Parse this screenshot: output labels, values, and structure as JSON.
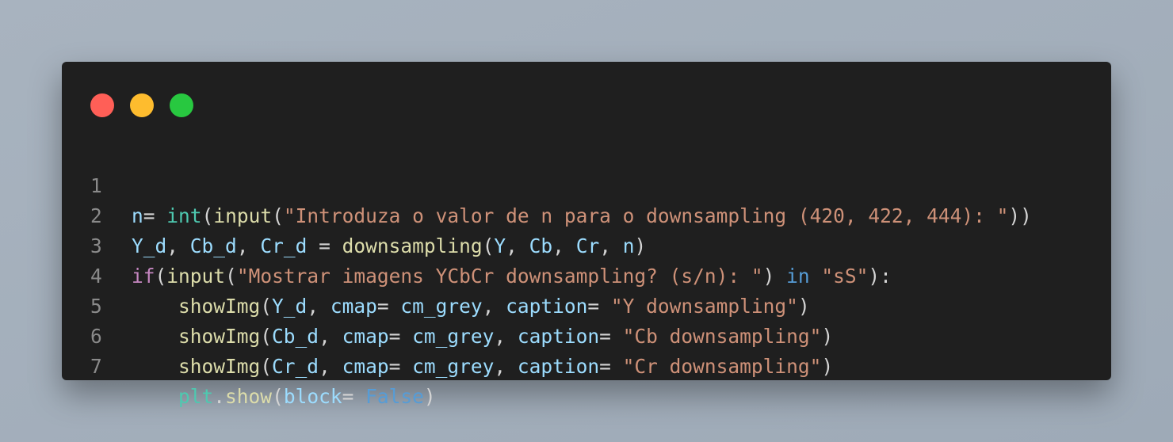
{
  "window": {
    "controls": [
      {
        "name": "close",
        "color": "#ff5f57"
      },
      {
        "name": "minimize",
        "color": "#febc2e"
      },
      {
        "name": "maximize",
        "color": "#28c840"
      }
    ]
  },
  "code": {
    "line_numbers": [
      "1",
      "2",
      "3",
      "4",
      "5",
      "6",
      "7"
    ],
    "lines": [
      [
        {
          "t": "n",
          "c": "var"
        },
        {
          "t": "= ",
          "c": "p"
        },
        {
          "t": "int",
          "c": "builtin"
        },
        {
          "t": "(",
          "c": "p"
        },
        {
          "t": "input",
          "c": "fn"
        },
        {
          "t": "(",
          "c": "p"
        },
        {
          "t": "\"Introduza o valor de n para o downsampling (420, 422, 444): \"",
          "c": "str"
        },
        {
          "t": "))",
          "c": "p"
        }
      ],
      [
        {
          "t": "Y_d",
          "c": "var"
        },
        {
          "t": ", ",
          "c": "p"
        },
        {
          "t": "Cb_d",
          "c": "var"
        },
        {
          "t": ", ",
          "c": "p"
        },
        {
          "t": "Cr_d",
          "c": "var"
        },
        {
          "t": " = ",
          "c": "p"
        },
        {
          "t": "downsampling",
          "c": "fn"
        },
        {
          "t": "(",
          "c": "p"
        },
        {
          "t": "Y",
          "c": "var"
        },
        {
          "t": ", ",
          "c": "p"
        },
        {
          "t": "Cb",
          "c": "var"
        },
        {
          "t": ", ",
          "c": "p"
        },
        {
          "t": "Cr",
          "c": "var"
        },
        {
          "t": ", ",
          "c": "p"
        },
        {
          "t": "n",
          "c": "var"
        },
        {
          "t": ")",
          "c": "p"
        }
      ],
      [
        {
          "t": "if",
          "c": "kw"
        },
        {
          "t": "(",
          "c": "p"
        },
        {
          "t": "input",
          "c": "fn"
        },
        {
          "t": "(",
          "c": "p"
        },
        {
          "t": "\"Mostrar imagens YCbCr downsampling? (s/n): \"",
          "c": "str"
        },
        {
          "t": ") ",
          "c": "p"
        },
        {
          "t": "in",
          "c": "const"
        },
        {
          "t": " ",
          "c": "p"
        },
        {
          "t": "\"sS\"",
          "c": "str"
        },
        {
          "t": "):",
          "c": "p"
        }
      ],
      [
        {
          "t": "    ",
          "c": "p"
        },
        {
          "t": "showImg",
          "c": "fn"
        },
        {
          "t": "(",
          "c": "p"
        },
        {
          "t": "Y_d",
          "c": "var"
        },
        {
          "t": ", ",
          "c": "p"
        },
        {
          "t": "cmap",
          "c": "var"
        },
        {
          "t": "= ",
          "c": "p"
        },
        {
          "t": "cm_grey",
          "c": "var"
        },
        {
          "t": ", ",
          "c": "p"
        },
        {
          "t": "caption",
          "c": "var"
        },
        {
          "t": "= ",
          "c": "p"
        },
        {
          "t": "\"Y downsampling\"",
          "c": "str"
        },
        {
          "t": ")",
          "c": "p"
        }
      ],
      [
        {
          "t": "    ",
          "c": "p"
        },
        {
          "t": "showImg",
          "c": "fn"
        },
        {
          "t": "(",
          "c": "p"
        },
        {
          "t": "Cb_d",
          "c": "var"
        },
        {
          "t": ", ",
          "c": "p"
        },
        {
          "t": "cmap",
          "c": "var"
        },
        {
          "t": "= ",
          "c": "p"
        },
        {
          "t": "cm_grey",
          "c": "var"
        },
        {
          "t": ", ",
          "c": "p"
        },
        {
          "t": "caption",
          "c": "var"
        },
        {
          "t": "= ",
          "c": "p"
        },
        {
          "t": "\"Cb downsampling\"",
          "c": "str"
        },
        {
          "t": ")",
          "c": "p"
        }
      ],
      [
        {
          "t": "    ",
          "c": "p"
        },
        {
          "t": "showImg",
          "c": "fn"
        },
        {
          "t": "(",
          "c": "p"
        },
        {
          "t": "Cr_d",
          "c": "var"
        },
        {
          "t": ", ",
          "c": "p"
        },
        {
          "t": "cmap",
          "c": "var"
        },
        {
          "t": "= ",
          "c": "p"
        },
        {
          "t": "cm_grey",
          "c": "var"
        },
        {
          "t": ", ",
          "c": "p"
        },
        {
          "t": "caption",
          "c": "var"
        },
        {
          "t": "= ",
          "c": "p"
        },
        {
          "t": "\"Cr downsampling\"",
          "c": "str"
        },
        {
          "t": ")",
          "c": "p"
        }
      ],
      [
        {
          "t": "    ",
          "c": "p"
        },
        {
          "t": "plt",
          "c": "builtin"
        },
        {
          "t": ".",
          "c": "p"
        },
        {
          "t": "show",
          "c": "fn"
        },
        {
          "t": "(",
          "c": "p"
        },
        {
          "t": "block",
          "c": "var"
        },
        {
          "t": "= ",
          "c": "p"
        },
        {
          "t": "False",
          "c": "const"
        },
        {
          "t": ")",
          "c": "p"
        }
      ]
    ]
  }
}
